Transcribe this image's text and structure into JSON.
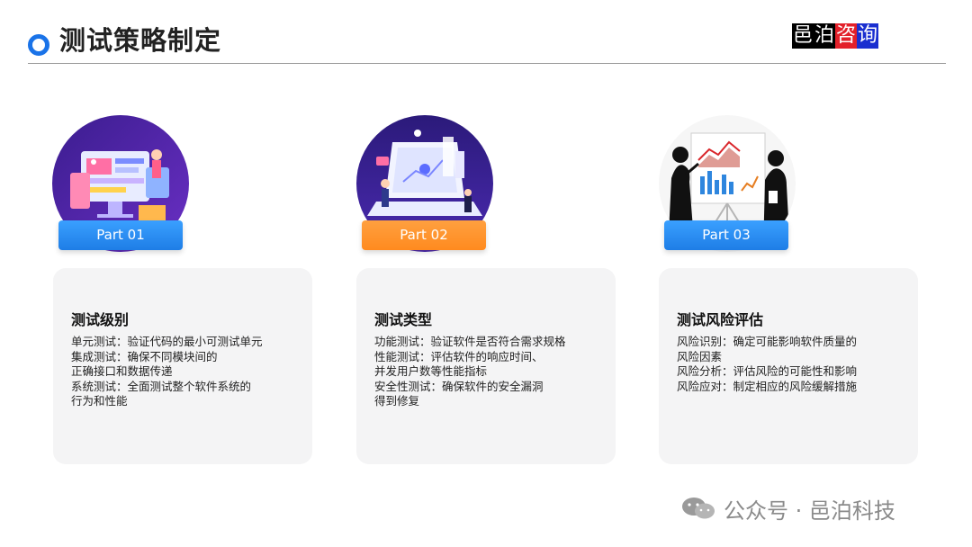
{
  "header": {
    "title": "测试策略制定",
    "logo": [
      "邑",
      "泊",
      "咨",
      "询"
    ]
  },
  "columns": [
    {
      "part_label": "Part 01",
      "card_title": "测试级别",
      "lines": [
        "单元测试：验证代码的最小可测试单元",
        "集成测试：确保不同模块间的",
        "正确接口和数据传递",
        "系统测试：全面测试整个软件系统的",
        "行为和性能"
      ]
    },
    {
      "part_label": "Part 02",
      "card_title": "测试类型",
      "lines": [
        "功能测试：验证软件是否符合需求规格",
        "性能测试：评估软件的响应时间、",
        "并发用户数等性能指标",
        "安全性测试：确保软件的安全漏洞",
        "得到修复"
      ]
    },
    {
      "part_label": "Part 03",
      "card_title": "测试风险评估",
      "lines": [
        "风险识别：确定可能影响软件质量的",
        "风险因素",
        "风险分析：评估风险的可能性和影响",
        "风险应对：制定相应的风险缓解措施"
      ]
    }
  ],
  "watermark": {
    "text": "公众号 · 邑泊科技",
    "icon": "wechat-icon"
  },
  "colors": {
    "accent_blue": "#1a73e8",
    "pill_blue": "#2a8cf0",
    "pill_orange": "#ff8f2a",
    "card_bg": "#f4f4f5"
  }
}
